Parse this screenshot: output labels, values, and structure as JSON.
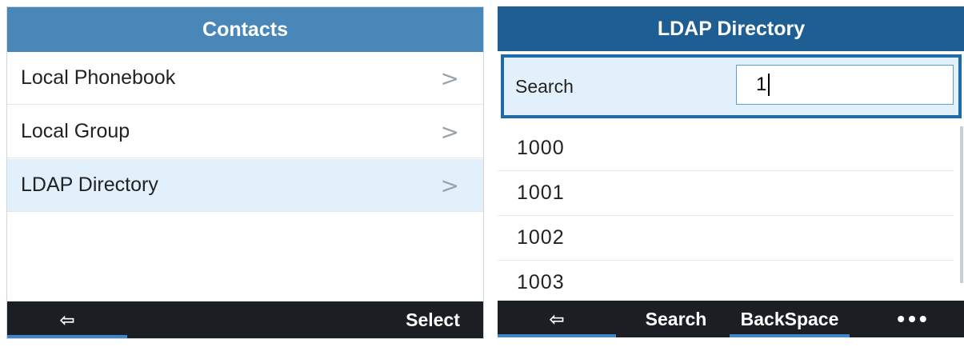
{
  "left": {
    "title": "Contacts",
    "items": [
      {
        "label": "Local Phonebook",
        "chevron": ">"
      },
      {
        "label": "Local Group",
        "chevron": ">"
      },
      {
        "label": "LDAP Directory",
        "chevron": ">",
        "selected": true
      }
    ],
    "softkeys": {
      "back_icon": "exit-icon",
      "back_glyph": "⇦",
      "select": "Select"
    }
  },
  "right": {
    "title": "LDAP Directory",
    "search": {
      "label": "Search",
      "value": "1"
    },
    "results": [
      "1000",
      "1001",
      "1002",
      "1003"
    ],
    "softkeys": {
      "back_icon": "exit-icon",
      "back_glyph": "⇦",
      "search": "Search",
      "backspace": "BackSpace",
      "more": "•••"
    }
  },
  "colors": {
    "left_title_bg": "#4a87b9",
    "right_title_bg": "#1f5e93",
    "selected_bg": "#e2f0fb",
    "softbar_bg": "#1b1f24",
    "accent": "#3f86c9"
  }
}
